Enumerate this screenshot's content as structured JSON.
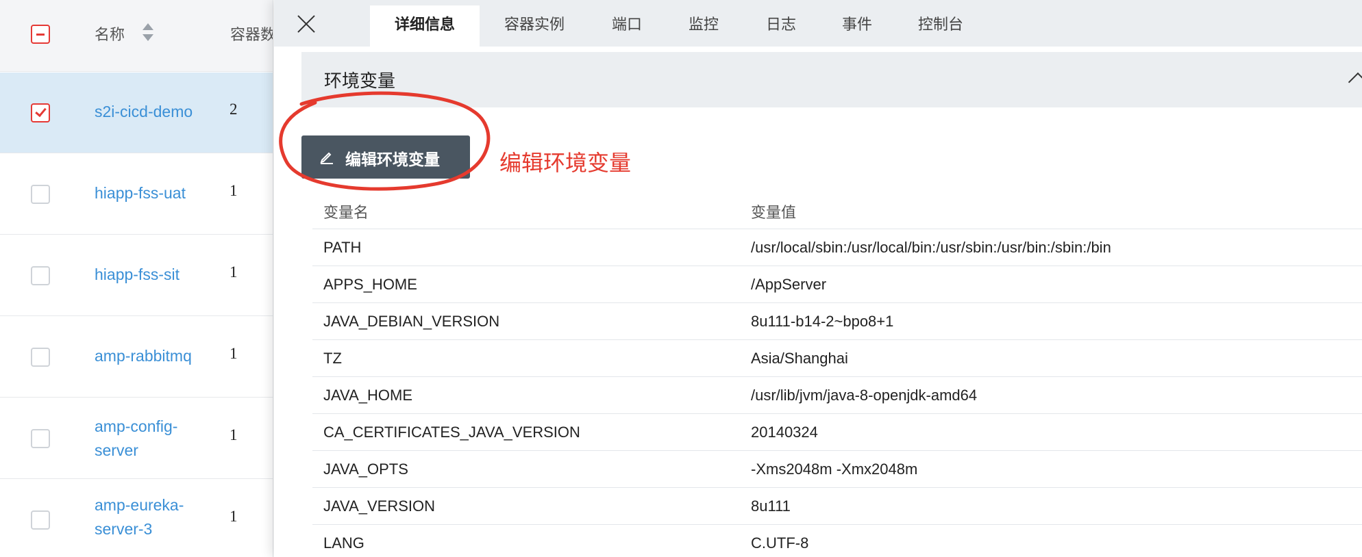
{
  "list": {
    "header": {
      "select_all": "indeterminate",
      "name_label": "名称",
      "count_label": "容器数"
    },
    "rows": [
      {
        "name": "s2i-cicd-demo",
        "count": "2",
        "selected": true
      },
      {
        "name": "hiapp-fss-uat",
        "count": "1",
        "selected": false
      },
      {
        "name": "hiapp-fss-sit",
        "count": "1",
        "selected": false
      },
      {
        "name": "amp-rabbitmq",
        "count": "1",
        "selected": false
      },
      {
        "name_lines": [
          "amp-config-",
          "server"
        ],
        "count": "1",
        "selected": false
      },
      {
        "name_lines": [
          "amp-eureka-",
          "server-3"
        ],
        "count": "1",
        "selected": false
      }
    ]
  },
  "detail": {
    "tabs": [
      {
        "label": "详细信息",
        "active": true
      },
      {
        "label": "容器实例",
        "active": false
      },
      {
        "label": "端口",
        "active": false
      },
      {
        "label": "监控",
        "active": false
      },
      {
        "label": "日志",
        "active": false
      },
      {
        "label": "事件",
        "active": false
      },
      {
        "label": "控制台",
        "active": false
      }
    ],
    "section_title": "环境变量",
    "edit_button_label": "编辑环境变量",
    "annotation_text": "编辑环境变量",
    "annotation_color": "#e53a2e",
    "env_table": {
      "key_header": "变量名",
      "value_header": "变量值",
      "rows": [
        {
          "key": "PATH",
          "value": "/usr/local/sbin:/usr/local/bin:/usr/sbin:/usr/bin:/sbin:/bin"
        },
        {
          "key": "APPS_HOME",
          "value": "/AppServer"
        },
        {
          "key": "JAVA_DEBIAN_VERSION",
          "value": "8u111-b14-2~bpo8+1"
        },
        {
          "key": "TZ",
          "value": "Asia/Shanghai"
        },
        {
          "key": "JAVA_HOME",
          "value": "/usr/lib/jvm/java-8-openjdk-amd64"
        },
        {
          "key": "CA_CERTIFICATES_JAVA_VERSION",
          "value": "20140324"
        },
        {
          "key": "JAVA_OPTS",
          "value": "-Xms2048m -Xmx2048m"
        },
        {
          "key": "JAVA_VERSION",
          "value": "8u111"
        },
        {
          "key": "LANG",
          "value": "C.UTF-8"
        }
      ]
    }
  },
  "colors": {
    "accent_link": "#3a8fd6",
    "checkbox_red": "#e53935",
    "button_dark": "#4a5661",
    "selected_row": "#daeaf6"
  }
}
